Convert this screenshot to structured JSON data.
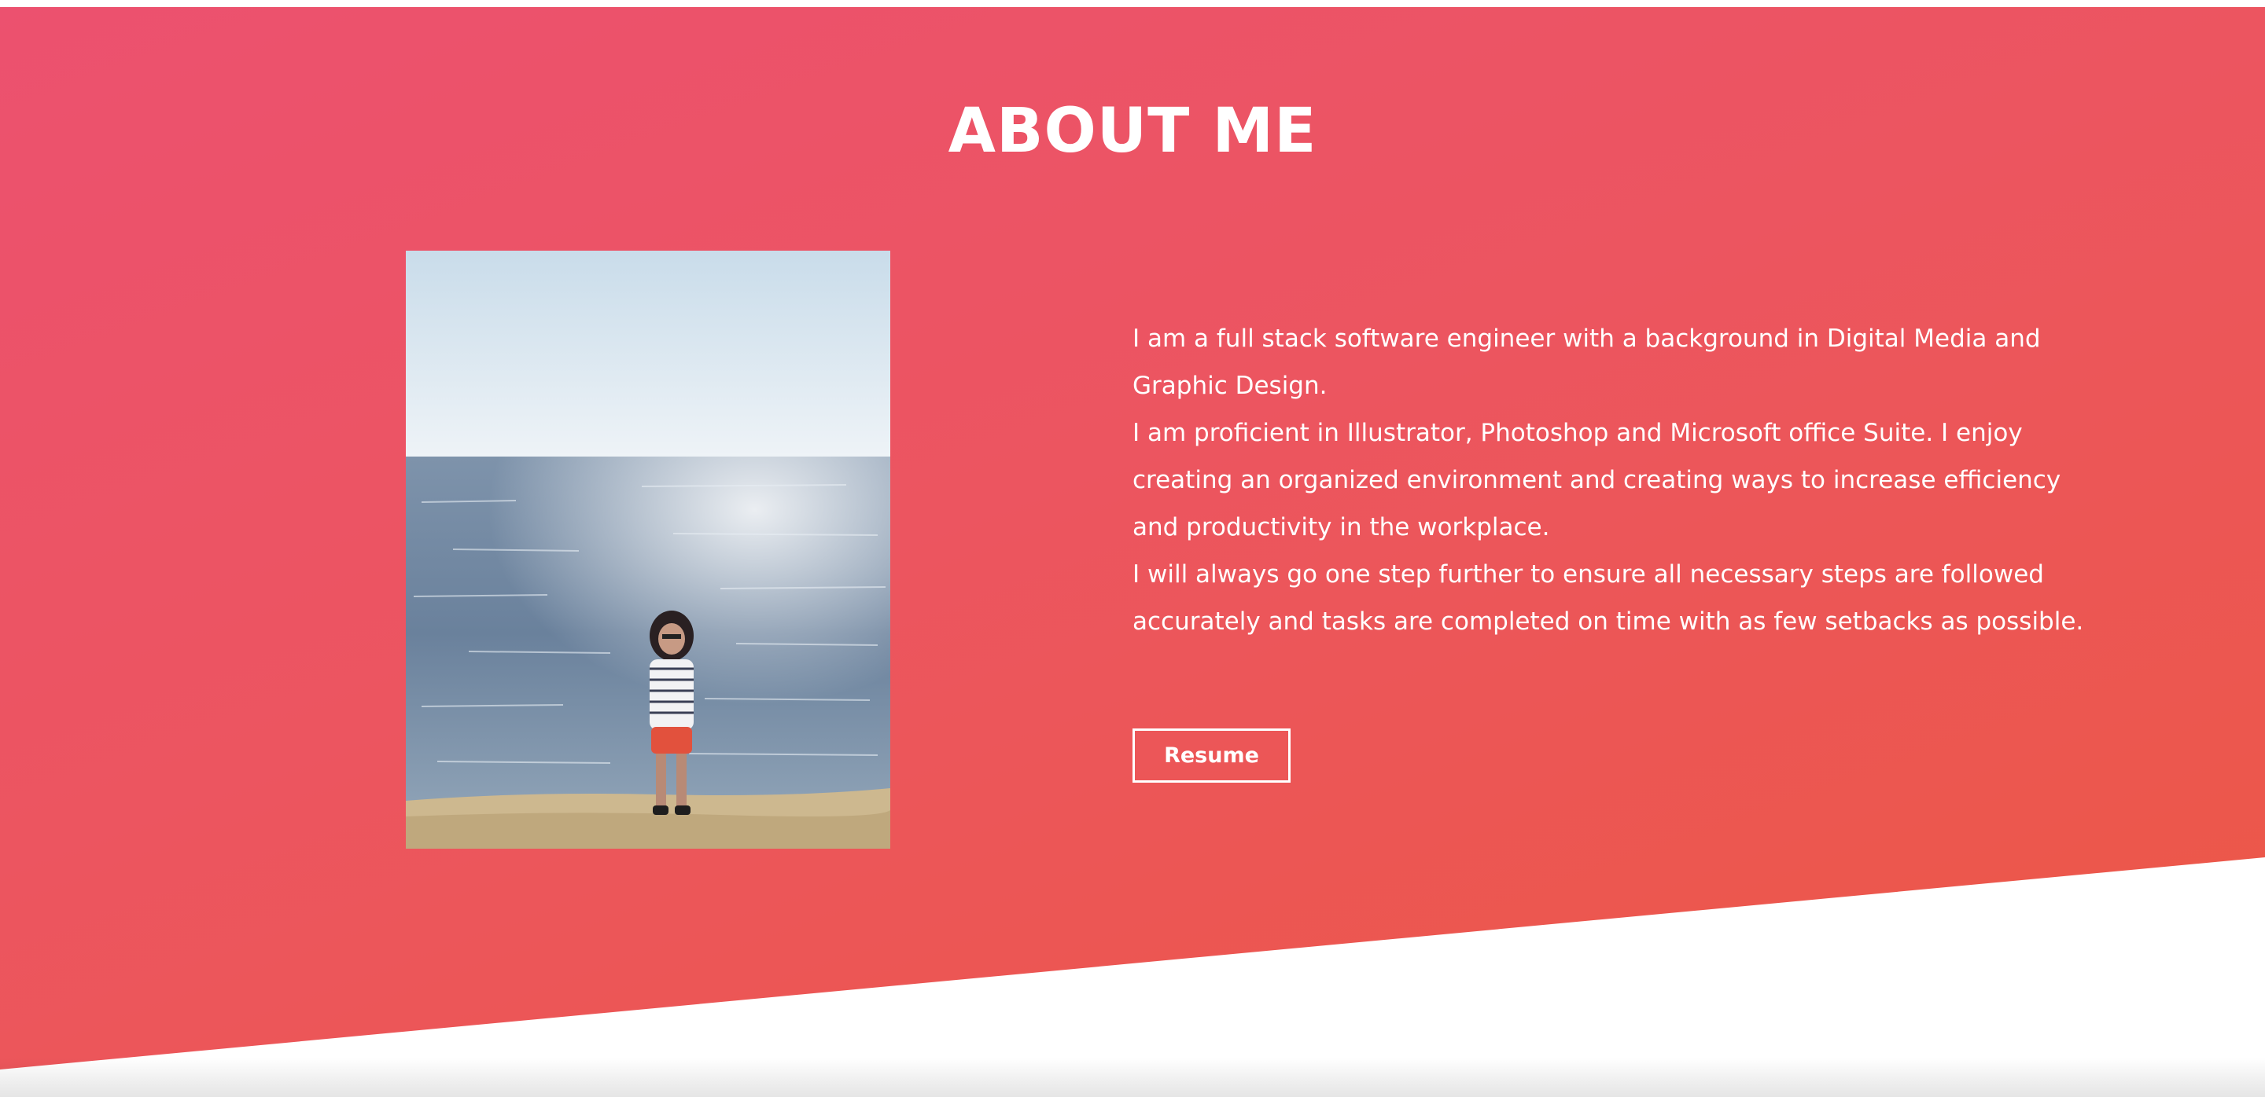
{
  "about": {
    "title": "ABOUT ME",
    "bio_paragraphs": [
      "I am a full stack software engineer with a background in Digital Media and Graphic Design.",
      "I am proficient in Illustrator, Photoshop and Microsoft office Suite. I enjoy creating an organized environment and creating ways to increase efficiency and productivity in the workplace.",
      "I will always go one step further to ensure all necessary steps are followed accurately and tasks are completed on time with as few setbacks as possible."
    ],
    "resume_label": "Resume"
  },
  "colors": {
    "gradient_start": "#ec516f",
    "gradient_end": "#ec5845",
    "text": "#ffffff"
  }
}
